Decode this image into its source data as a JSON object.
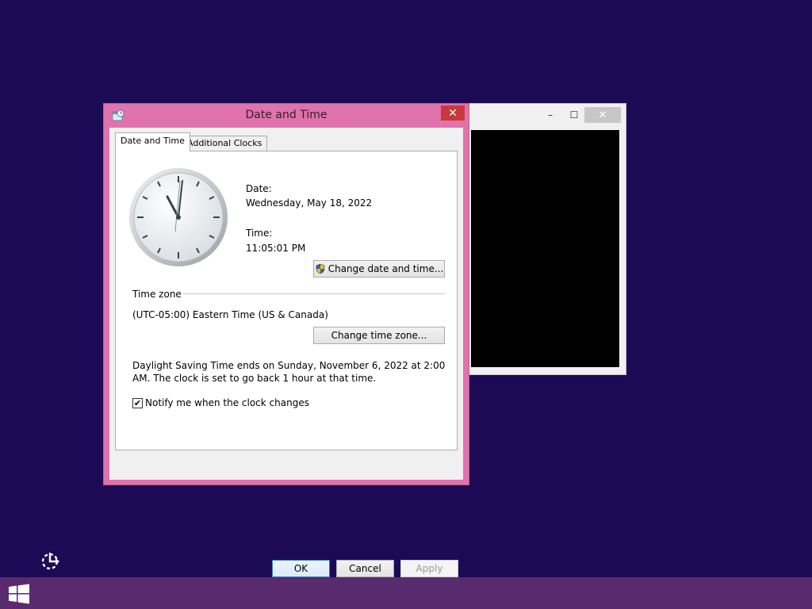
{
  "background_window": {
    "minimize_glyph": "–",
    "maximize_glyph": "☐",
    "close_glyph": "✕"
  },
  "dialog": {
    "title": "Date and Time",
    "close_glyph": "✕",
    "tabs": [
      {
        "label": "Date and Time",
        "active": true
      },
      {
        "label": "Additional Clocks",
        "active": false
      }
    ],
    "date_label": "Date:",
    "date_value": "Wednesday, May 18, 2022",
    "time_label": "Time:",
    "time_value": "11:05:01 PM",
    "change_datetime_button": "Change date and time...",
    "timezone_header": "Time zone",
    "timezone_value": "(UTC-05:00) Eastern Time (US & Canada)",
    "change_timezone_button": "Change time zone...",
    "dst_text": "Daylight Saving Time ends on Sunday, November 6, 2022 at 2:00 AM. The clock is set to go back 1 hour at that time.",
    "notify_label": "Notify me when the clock changes",
    "notify_checked": true,
    "ok_button": "OK",
    "cancel_button": "Cancel",
    "apply_button": "Apply"
  },
  "icons": {
    "title": "datetime-settings-icon",
    "uac": "uac-shield-icon",
    "start": "windows-logo-icon",
    "desktop": "network-cursor-icon"
  },
  "colors": {
    "desktop": "#1c0a55",
    "dialog_frame": "#e072ac",
    "close_button": "#c7393a",
    "taskbar": "#5a2a6e"
  }
}
